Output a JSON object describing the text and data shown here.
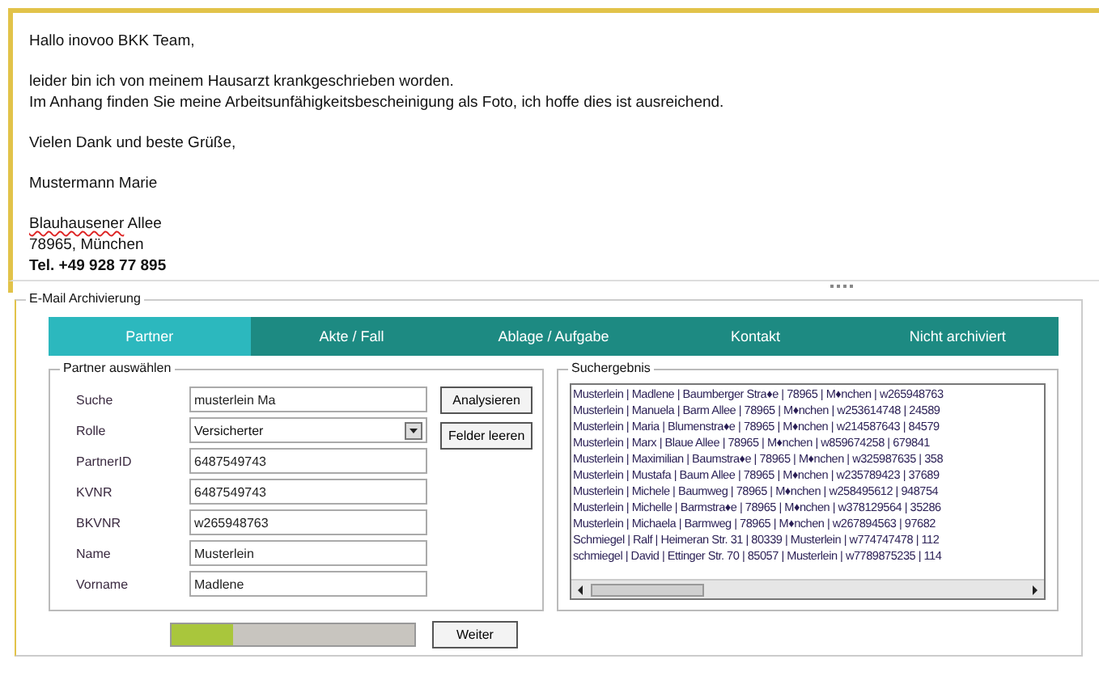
{
  "email": {
    "greeting": "Hallo inovoo BKK Team,",
    "body": [
      "leider bin ich von meinem Hausarzt krankgeschrieben worden.",
      "Im Anhang finden Sie meine Arbeitsunfähigkeitsbescheinigung als Foto, ich hoffe dies ist ausreichend."
    ],
    "closing": "Vielen Dank und beste Grüße,",
    "sender": "Mustermann Marie",
    "address": [
      {
        "text": "Blauhausener",
        "misspelled": true
      },
      {
        "text": "Allee",
        "misspelled": false
      }
    ],
    "city": "78965,  München",
    "phone": "Tel. +49 928 77 895"
  },
  "archive": {
    "title": "E-Mail Archivierung",
    "tabs": [
      {
        "label": "Partner",
        "selected": true
      },
      {
        "label": "Akte / Fall",
        "selected": false
      },
      {
        "label": "Ablage / Aufgabe",
        "selected": false
      },
      {
        "label": "Kontakt",
        "selected": false
      },
      {
        "label": "Nicht archiviert",
        "selected": false
      }
    ],
    "partner": {
      "title": "Partner auswählen",
      "fields": [
        {
          "label": "Suche",
          "value": "musterlein Ma",
          "kind": "text"
        },
        {
          "label": "Rolle",
          "value": "Versicherter",
          "kind": "dropdown"
        },
        {
          "label": "PartnerID",
          "value": "6487549743",
          "kind": "text"
        },
        {
          "label": "KVNR",
          "value": "6487549743",
          "kind": "text"
        },
        {
          "label": "BKVNR",
          "value": "w265948763",
          "kind": "text"
        },
        {
          "label": "Name",
          "value": "Musterlein",
          "kind": "text"
        },
        {
          "label": "Vorname",
          "value": "Madlene",
          "kind": "text"
        }
      ],
      "buttons": [
        "Analysieren",
        "Felder leeren"
      ]
    },
    "results": {
      "title": "Suchergebnis",
      "rows": [
        "Musterlein | Madlene | Baumberger Stra♦e | 78965 | M♦nchen | w265948763",
        "Musterlein | Manuela | Barm Allee | 78965 | M♦nchen | w253614748 | 24589",
        "Musterlein | Maria | Blumenstra♦e | 78965 | M♦nchen | w214587643 | 84579",
        "Musterlein | Marx | Blaue Allee | 78965 | M♦nchen | w859674258 | 679841",
        "Musterlein | Maximilian | Baumstra♦e | 78965 | M♦nchen | w325987635 | 358",
        "Musterlein | Mustafa | Baum Allee | 78965 | M♦nchen | w235789423 | 37689",
        "Musterlein | Michele | Baumweg | 78965 | M♦nchen | w258495612 | 948754",
        "Musterlein | Michelle | Barmstra♦e | 78965 | M♦nchen | w378129564 | 35286",
        "Musterlein | Michaela | Barmweg | 78965 | M♦nchen | w267894563 | 97682",
        "Schmiegel | Ralf | Heimeran Str. 31 | 80339 | Musterlein | w774747478 | 112",
        "schmiegel | David | Ettinger Str. 70 | 85057 | Musterlein | w7789875235 | 114"
      ]
    },
    "progress": {
      "level": 0.25
    },
    "next_button": "Weiter"
  }
}
